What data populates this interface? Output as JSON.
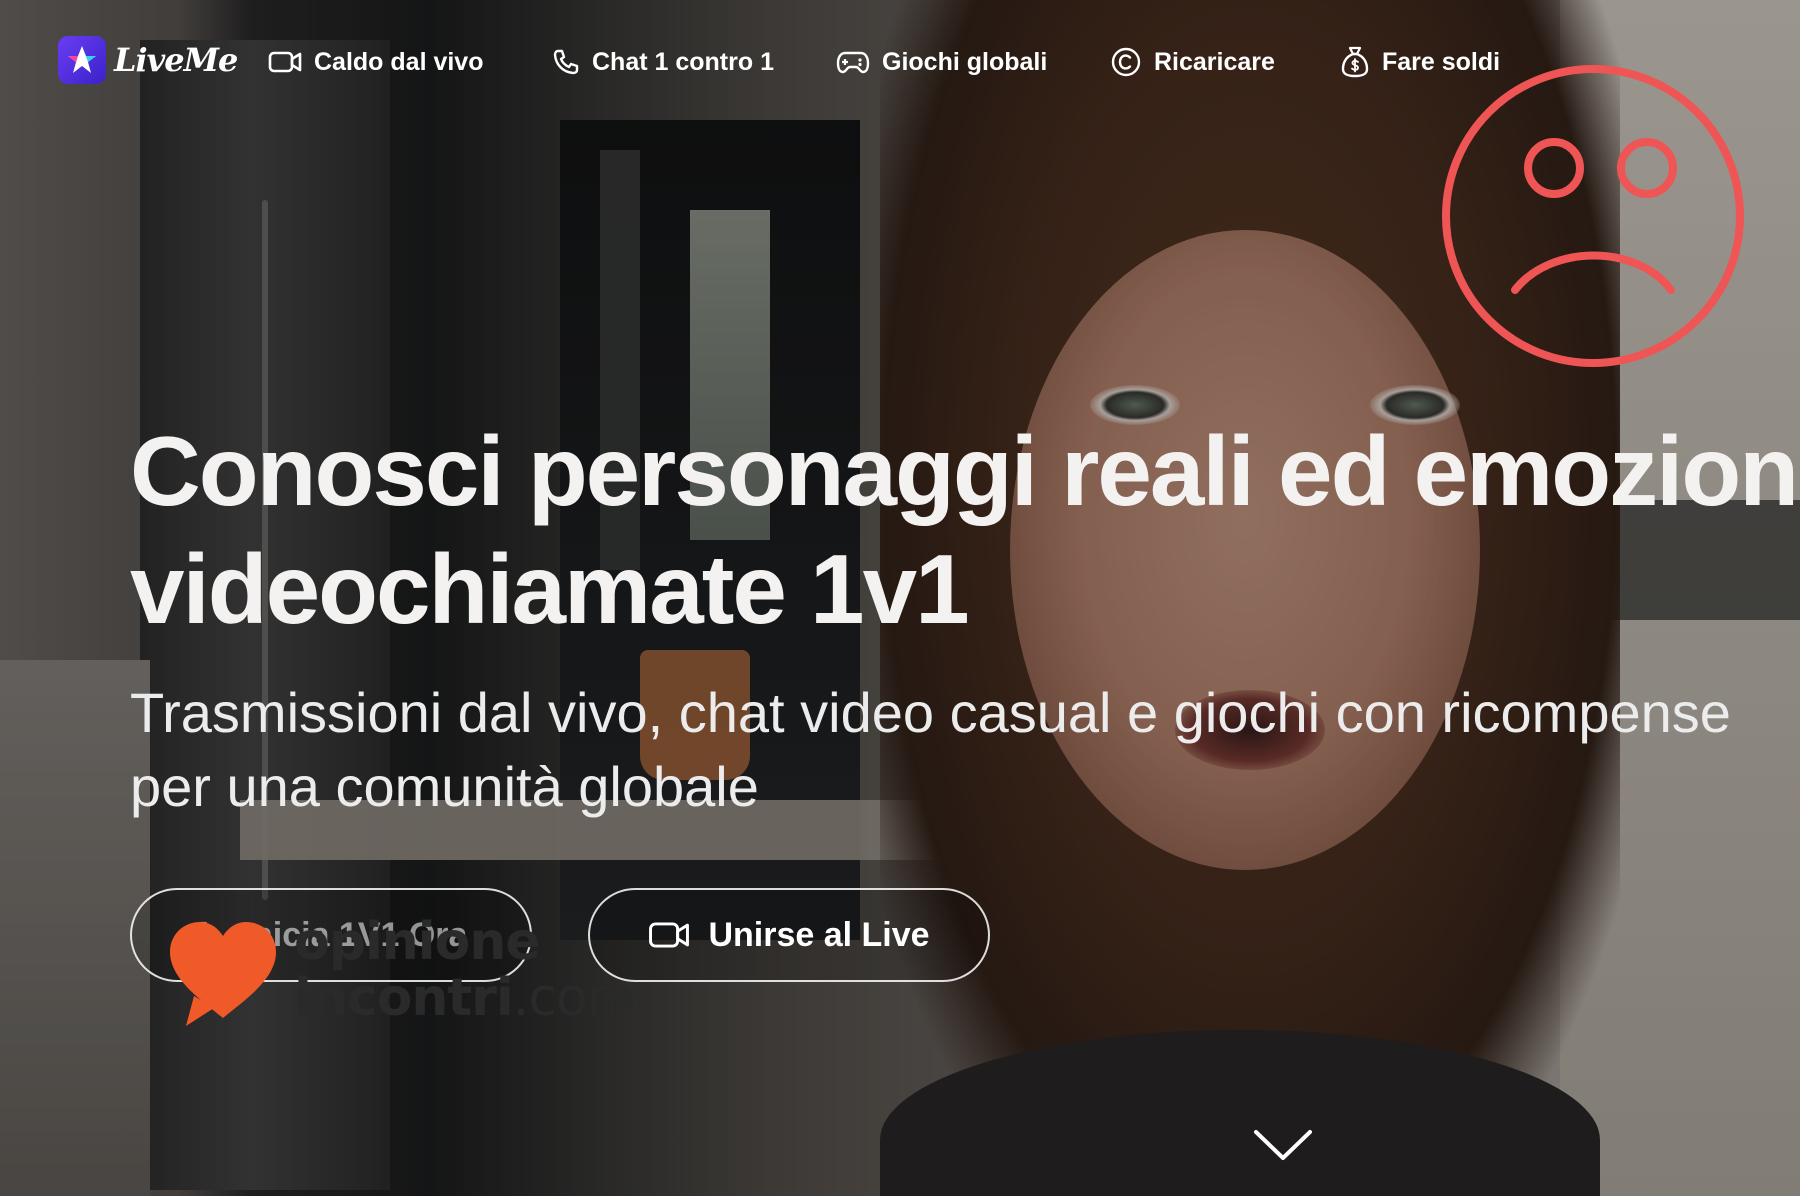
{
  "brand": {
    "logo_text": "LiveMe",
    "accent": "#5a34e6"
  },
  "nav": {
    "items": [
      {
        "label": "Caldo dal vivo",
        "icon": "video-camera-icon"
      },
      {
        "label": "Chat 1 contro 1",
        "icon": "phone-icon"
      },
      {
        "label": "Giochi globali",
        "icon": "gamepad-icon"
      },
      {
        "label": "Ricaricare",
        "icon": "coin-icon"
      },
      {
        "label": "Fare soldi",
        "icon": "money-bag-icon"
      }
    ]
  },
  "hero": {
    "headline_line1": "Conosci personaggi reali ed emozionanti",
    "headline_line2": "videochiamate 1v1",
    "subline_line1": "Trasmissioni dal vivo, chat video casual e giochi con ricompense",
    "subline_line2": "per una comunità globale"
  },
  "cta": {
    "start_label": "Inicia 1V1 Ora",
    "live_label": "Unirse al Live"
  },
  "watermark": {
    "line1": "opinione",
    "line2_bold": "incontri",
    "line2_rest": ".com",
    "heart_color": "#f05a28"
  },
  "overlay": {
    "sad_face_color": "#f05555"
  }
}
